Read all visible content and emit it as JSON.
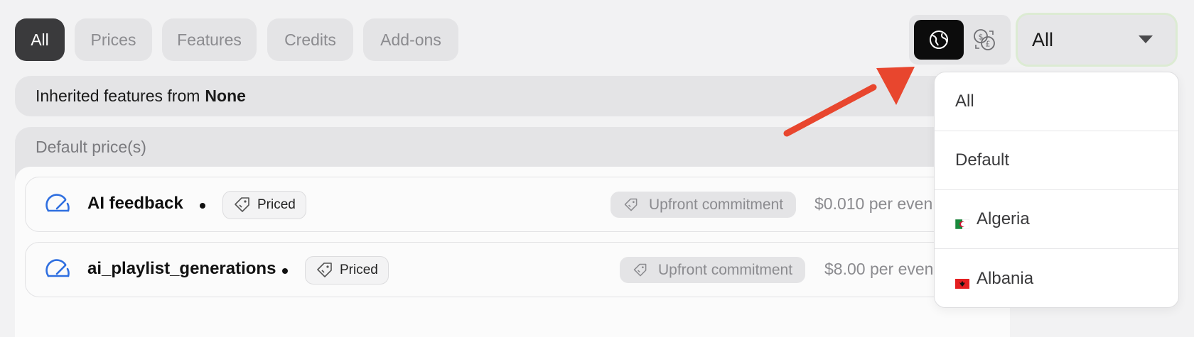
{
  "filter_tabs": [
    {
      "label": "All",
      "active": true
    },
    {
      "label": "Prices",
      "active": false
    },
    {
      "label": "Features",
      "active": false
    },
    {
      "label": "Credits",
      "active": false
    },
    {
      "label": "Add-ons",
      "active": false
    }
  ],
  "view_toggle": {
    "options": [
      {
        "icon": "globe-icon",
        "active": true
      },
      {
        "icon": "currency-exchange-icon",
        "active": false
      }
    ]
  },
  "region_select": {
    "value": "All",
    "options": [
      {
        "label": "All",
        "flag": ""
      },
      {
        "label": "Default",
        "flag": ""
      },
      {
        "label": "Algeria",
        "flag": "flag-algeria"
      },
      {
        "label": "Albania",
        "flag": "flag-albania"
      }
    ]
  },
  "inherited": {
    "prefix": "Inherited features from",
    "value": "None"
  },
  "default_prices": {
    "title": "Default price(s)",
    "rows": [
      {
        "name": "AI feedback",
        "badge": "Priced",
        "commitment": "Upfront commitment",
        "price": "$0.010 per even"
      },
      {
        "name": "ai_playlist_generations",
        "badge": "Priced",
        "commitment": "Upfront commitment",
        "price": "$8.00 per even"
      }
    ]
  },
  "colors": {
    "accent_blue": "#2f6fe0",
    "annotation_arrow": "#e8462e",
    "active_tab": "#3a3a3c"
  }
}
